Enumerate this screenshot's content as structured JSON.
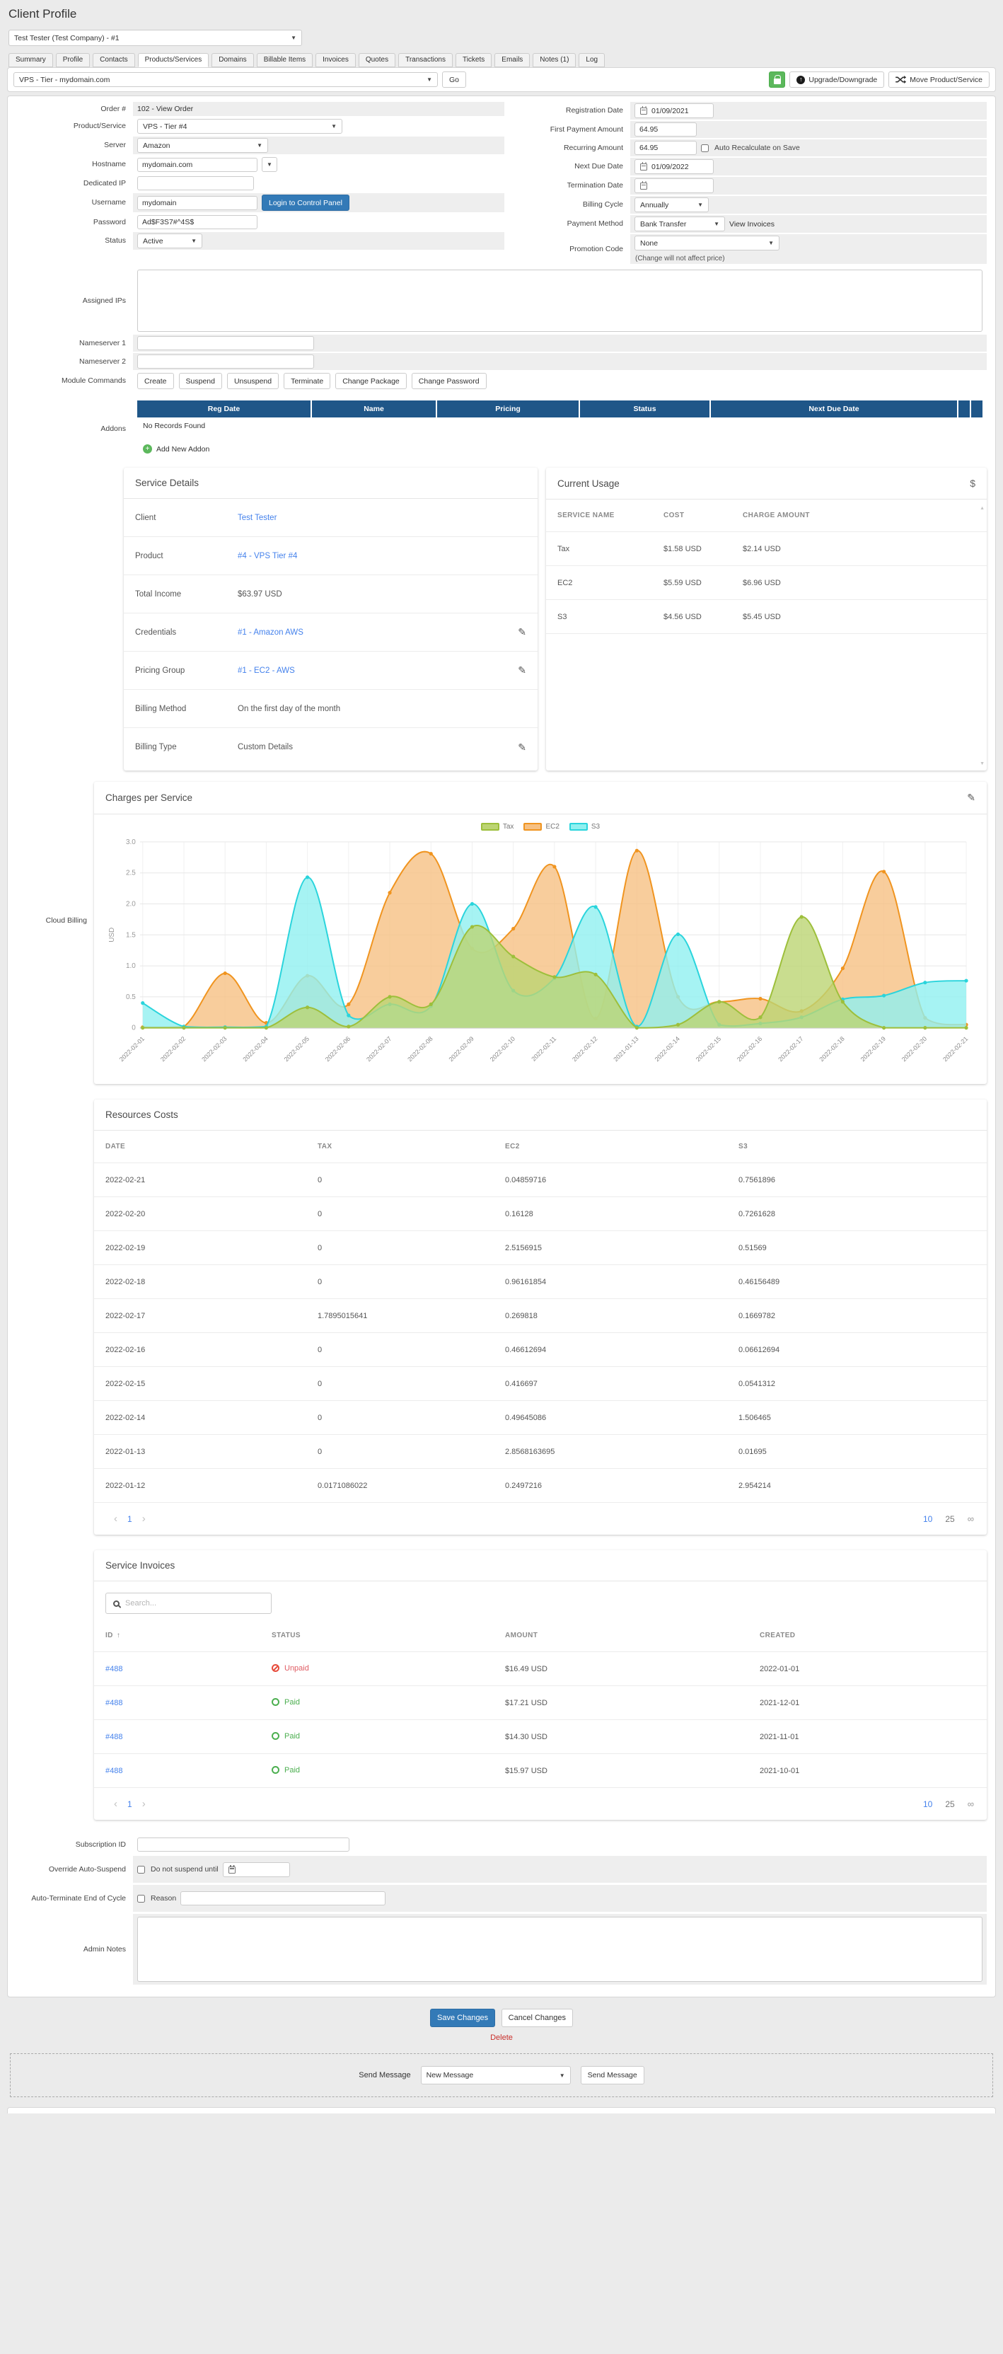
{
  "page": {
    "title": "Client Profile"
  },
  "client_selector": {
    "value": "Test Tester (Test Company) - #1"
  },
  "tabs": {
    "items": [
      "Summary",
      "Profile",
      "Contacts",
      "Products/Services",
      "Domains",
      "Billable Items",
      "Invoices",
      "Quotes",
      "Transactions",
      "Tickets",
      "Emails",
      "Notes (1)",
      "Log"
    ]
  },
  "toolbar": {
    "service_select": "VPS - Tier - mydomain.com",
    "go_button": "Go",
    "upgrade_button": "Upgrade/Downgrade",
    "move_button": "Move Product/Service"
  },
  "form": {
    "order_label": "Order #",
    "order_value": "102 - View Order",
    "product_label": "Product/Service",
    "product_value": "VPS - Tier #4",
    "server_label": "Server",
    "server_value": "Amazon",
    "hostname_label": "Hostname",
    "hostname_value": "mydomain.com",
    "dedicated_ip_label": "Dedicated IP",
    "dedicated_ip_value": "",
    "username_label": "Username",
    "username_value": "mydomain",
    "login_button": "Login to Control Panel",
    "password_label": "Password",
    "password_value": "Ad$F3S7#^4S$",
    "status_label": "Status",
    "status_value": "Active",
    "registration_label": "Registration Date",
    "registration_value": "01/09/2021",
    "first_payment_label": "First Payment Amount",
    "first_payment_value": "64.95",
    "recurring_label": "Recurring Amount",
    "recurring_value": "64.95",
    "recalc_label": "Auto Recalculate on Save",
    "next_due_label": "Next Due Date",
    "next_due_value": "01/09/2022",
    "termination_label": "Termination Date",
    "termination_value": "",
    "billing_cycle_label": "Billing Cycle",
    "billing_cycle_value": "Annually",
    "payment_method_label": "Payment Method",
    "payment_method_value": "Bank Transfer",
    "view_invoices": "View Invoices",
    "promo_label": "Promotion Code",
    "promo_value": "None",
    "promo_note": "(Change will not affect price)",
    "assigned_ips_label": "Assigned IPs",
    "ns1_label": "Nameserver 1",
    "ns2_label": "Nameserver 2"
  },
  "module_commands": {
    "label": "Module Commands",
    "buttons": [
      "Create",
      "Suspend",
      "Unsuspend",
      "Terminate",
      "Change Package",
      "Change Password"
    ]
  },
  "addons": {
    "label": "Addons",
    "headers": [
      "Reg Date",
      "Name",
      "Pricing",
      "Status",
      "Next Due Date"
    ],
    "empty_text": "No Records Found",
    "add_link": "Add New Addon"
  },
  "service_details": {
    "title": "Service Details",
    "rows": [
      {
        "label": "Client",
        "value": "Test Tester"
      },
      {
        "label": "Product",
        "value": "#4 - VPS Tier #4"
      },
      {
        "label": "Total Income",
        "value": "$63.97 USD"
      },
      {
        "label": "Credentials",
        "value": "#1 - Amazon AWS"
      },
      {
        "label": "Pricing Group",
        "value": "#1 - EC2 - AWS"
      },
      {
        "label": "Billing Method",
        "value": "On the first day of the month"
      },
      {
        "label": "Billing Type",
        "value": "Custom Details"
      }
    ]
  },
  "current_usage": {
    "title": "Current Usage",
    "headers": [
      "SERVICE NAME",
      "COST",
      "CHARGE AMOUNT"
    ],
    "rows": [
      {
        "name": "Tax",
        "cost": "$1.58 USD",
        "charge": "$2.14 USD"
      },
      {
        "name": "EC2",
        "cost": "$5.59 USD",
        "charge": "$6.96 USD"
      },
      {
        "name": "S3",
        "cost": "$4.56 USD",
        "charge": "$5.45 USD"
      }
    ]
  },
  "billing": {
    "row_label": "Cloud Billing",
    "chart_title": "Charges per Service"
  },
  "chart_data": {
    "type": "area",
    "title": "Charges per Service",
    "ylabel": "USD",
    "ylim": [
      0,
      3
    ],
    "yticks": [
      0,
      0.5,
      1.0,
      1.5,
      2.0,
      2.5,
      3.0
    ],
    "grid": true,
    "legend_position": "top",
    "x": [
      "2022-02-01",
      "2022-02-02",
      "2022-02-03",
      "2022-02-04",
      "2022-02-05",
      "2022-02-06",
      "2022-02-07",
      "2022-02-08",
      "2022-02-09",
      "2022-02-10",
      "2022-02-11",
      "2022-02-12",
      "2021-01-13",
      "2022-02-14",
      "2022-02-15",
      "2022-02-16",
      "2022-02-17",
      "2022-02-18",
      "2022-02-19",
      "2022-02-20",
      "2022-02-21"
    ],
    "series": [
      {
        "name": "EC2",
        "color": "#f0941f",
        "fill": "#f6c083",
        "values": [
          0.01,
          0.02,
          0.88,
          0.08,
          0.84,
          0.38,
          2.18,
          2.81,
          1.28,
          1.6,
          2.6,
          0.15,
          2.86,
          0.5,
          0.42,
          0.47,
          0.27,
          0.96,
          2.52,
          0.16,
          0.05
        ]
      },
      {
        "name": "S3",
        "color": "#2ad4dc",
        "fill": "#90f0f0",
        "values": [
          0.4,
          0.02,
          0.01,
          0.02,
          2.43,
          0.2,
          0.38,
          0.35,
          2.0,
          0.6,
          0.8,
          1.95,
          0.02,
          1.51,
          0.05,
          0.07,
          0.17,
          0.46,
          0.52,
          0.73,
          0.76
        ]
      },
      {
        "name": "Tax",
        "color": "#9dbf3b",
        "fill": "#bcd473",
        "values": [
          0,
          0,
          0,
          0,
          0.33,
          0.02,
          0.5,
          0.38,
          1.63,
          1.15,
          0.82,
          0.86,
          0,
          0.05,
          0.42,
          0.17,
          1.79,
          0.42,
          0,
          0,
          0
        ]
      }
    ],
    "legend_order": [
      "Tax",
      "EC2",
      "S3"
    ]
  },
  "resources": {
    "title": "Resources Costs",
    "headers": [
      "DATE",
      "TAX",
      "EC2",
      "S3"
    ],
    "rows": [
      [
        "2022-02-21",
        "0",
        "0.04859716",
        "0.7561896"
      ],
      [
        "2022-02-20",
        "0",
        "0.16128",
        "0.7261628"
      ],
      [
        "2022-02-19",
        "0",
        "2.5156915",
        "0.51569"
      ],
      [
        "2022-02-18",
        "0",
        "0.96161854",
        "0.46156489"
      ],
      [
        "2022-02-17",
        "1.7895015641",
        "0.269818",
        "0.1669782"
      ],
      [
        "2022-02-16",
        "0",
        "0.46612694",
        "0.06612694"
      ],
      [
        "2022-02-15",
        "0",
        "0.416697",
        "0.0541312"
      ],
      [
        "2022-02-14",
        "0",
        "0.49645086",
        "1.506465"
      ],
      [
        "2022-01-13",
        "0",
        "2.8568163695",
        "0.01695"
      ],
      [
        "2022-01-12",
        "0.0171086022",
        "0.2497216",
        "2.954214"
      ]
    ]
  },
  "invoices": {
    "title": "Service Invoices",
    "search_placeholder": "Search...",
    "headers": [
      "ID",
      "STATUS",
      "AMOUNT",
      "CREATED"
    ],
    "rows": [
      {
        "id": "#488",
        "status": "Unpaid",
        "amount": "$16.49 USD",
        "created": "2022-01-01"
      },
      {
        "id": "#488",
        "status": "Paid",
        "amount": "$17.21 USD",
        "created": "2021-12-01"
      },
      {
        "id": "#488",
        "status": "Paid",
        "amount": "$14.30 USD",
        "created": "2021-11-01"
      },
      {
        "id": "#488",
        "status": "Paid",
        "amount": "$15.97 USD",
        "created": "2021-10-01"
      }
    ]
  },
  "pagination": {
    "prev": "‹",
    "page": "1",
    "next": "›",
    "size_10": "10",
    "size_25": "25",
    "all": "∞"
  },
  "bottom": {
    "subscription_label": "Subscription ID",
    "override_label": "Override Auto-Suspend",
    "override_checkbox": "Do not suspend until",
    "terminate_label": "Auto-Terminate End of Cycle",
    "reason_checkbox": "Reason",
    "admin_notes_label": "Admin Notes"
  },
  "footer": {
    "save": "Save Changes",
    "cancel": "Cancel Changes",
    "delete": "Delete",
    "send_label": "Send Message",
    "send_value": "New Message",
    "send_button": "Send Message"
  },
  "colors": {
    "accent": "#337ab7",
    "table_header": "#1f5688",
    "link": "#4582ec",
    "paid": "#4caf50",
    "unpaid": "#e74c3c",
    "tax": "#9dbf3b",
    "ec2": "#f0941f",
    "s3": "#2ad4dc"
  }
}
